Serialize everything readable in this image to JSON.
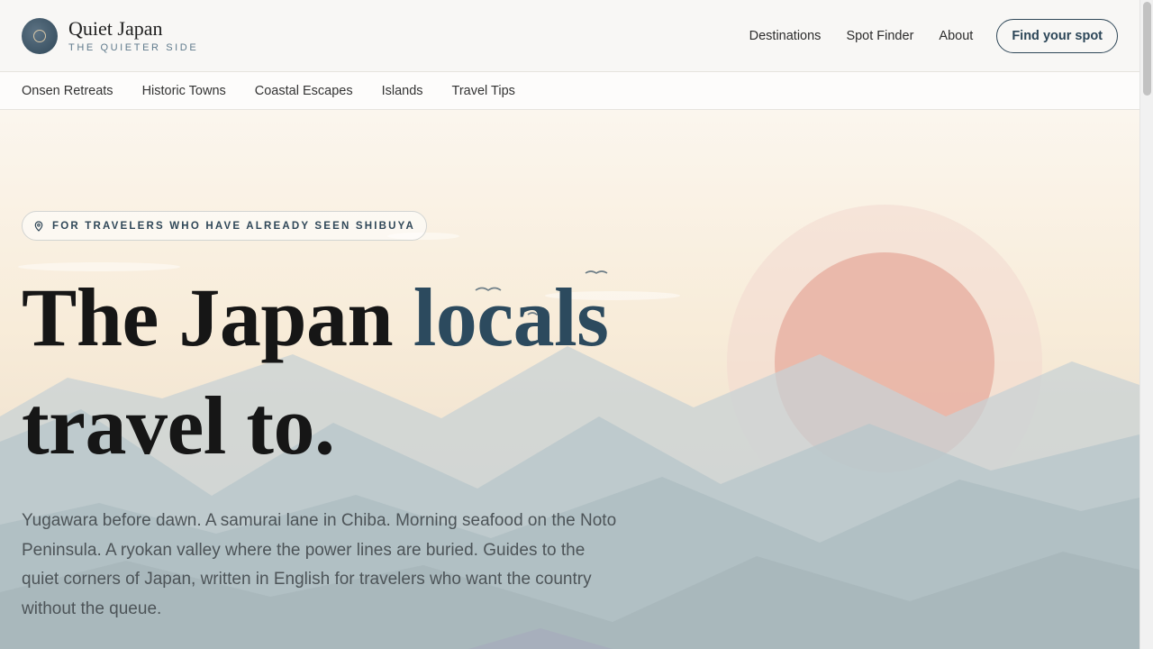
{
  "brand": {
    "name": "Quiet Japan",
    "tagline": "THE QUIETER SIDE"
  },
  "nav": {
    "links": [
      "Destinations",
      "Spot Finder",
      "About"
    ],
    "cta": "Find your spot"
  },
  "subnav": {
    "items": [
      "Onsen Retreats",
      "Historic Towns",
      "Coastal Escapes",
      "Islands",
      "Travel Tips"
    ]
  },
  "hero": {
    "tag": "FOR TRAVELERS WHO HAVE ALREADY SEEN SHIBUYA",
    "headline_part1": "The Japan ",
    "headline_accent": "locals",
    "headline_part2": "travel to.",
    "lede": "Yugawara before dawn. A samurai lane in Chiba. Morning seafood on the Noto Peninsula. A ryokan valley where the power lines are buried. Guides to the quiet corners of Japan, written in English for travelers who want the country without the queue."
  },
  "colors": {
    "accent": "#2c4a5e",
    "sun": "#e8b1a3",
    "mountains": "#b7c6ca"
  },
  "icons": {
    "logo": "logo-circle-icon",
    "tag": "location-pin-icon",
    "birds": "bird-icon"
  }
}
